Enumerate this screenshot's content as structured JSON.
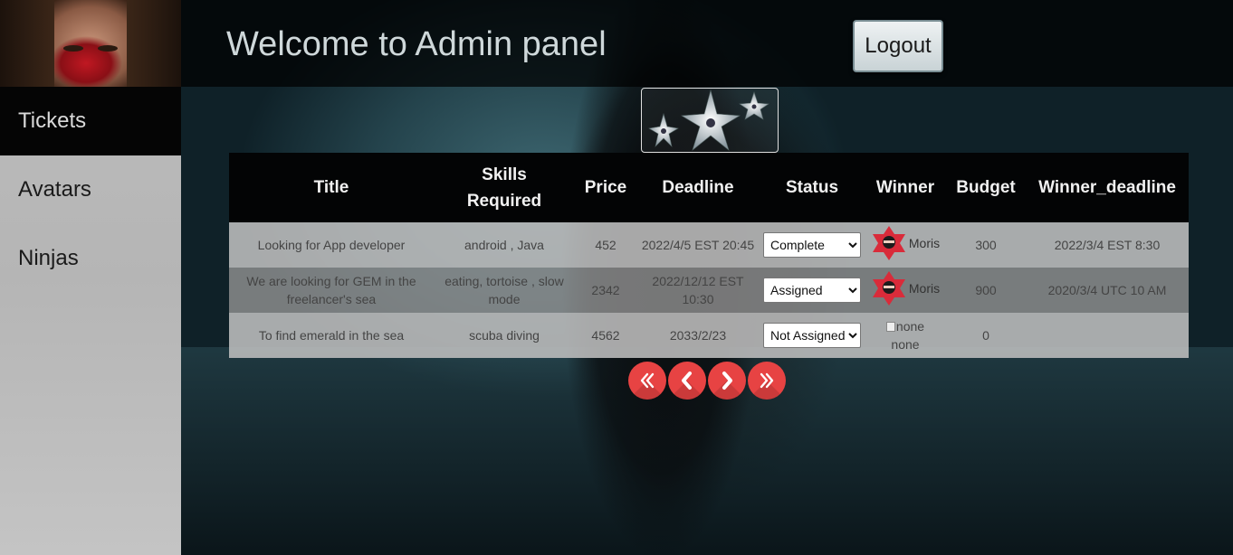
{
  "header": {
    "title": "Welcome to Admin panel",
    "logout_label": "Logout"
  },
  "sidebar": {
    "items": [
      {
        "label": "Tickets",
        "active": true
      },
      {
        "label": "Avatars",
        "active": false
      },
      {
        "label": "Ninjas",
        "active": false
      }
    ]
  },
  "table": {
    "columns": [
      "Title",
      "Skills Required",
      "Price",
      "Deadline",
      "Status",
      "Winner",
      "Budget",
      "Winner_deadline"
    ],
    "rows": [
      {
        "title": "Looking for App developer",
        "skills": "android , Java",
        "price": "452",
        "deadline": "2022/4/5 EST 20:45",
        "status": "Complete",
        "winner": "Moris",
        "budget": "300",
        "winner_deadline": "2022/3/4 EST 8:30"
      },
      {
        "title": "We are looking for GEM in the freelancer's sea",
        "skills": "eating, tortoise , slow mode",
        "price": "2342",
        "deadline": "2022/12/12 EST 10:30",
        "status": "Assigned",
        "winner": "Moris",
        "budget": "900",
        "winner_deadline": "2020/3/4 UTC 10 AM"
      },
      {
        "title": "To find emerald in the sea",
        "skills": "scuba diving",
        "price": "4562",
        "deadline": "2033/2/23",
        "status": "Not Assigned",
        "winner_alt": "none",
        "winner": "none",
        "budget": "0",
        "winner_deadline": ""
      }
    ]
  },
  "icons": {
    "logo": "shuriken-logo-icon",
    "winner_avatar": "ninja-star-avatar-icon",
    "pager": [
      "double-chevron-left-icon",
      "chevron-left-icon",
      "chevron-right-icon",
      "double-chevron-right-icon"
    ]
  },
  "colors": {
    "accent": "#e74343",
    "winner_star": "#d92b3a",
    "header_bg": "#030405",
    "sidebar_active": "#050505"
  }
}
